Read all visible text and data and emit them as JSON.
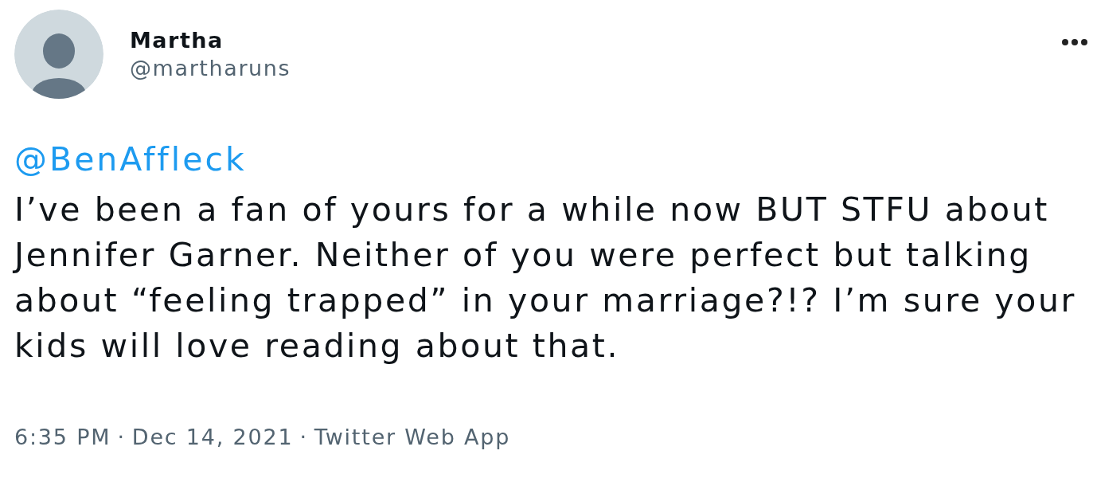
{
  "author": {
    "name": "Martha",
    "handle": "@martharuns"
  },
  "tweet": {
    "mention": "@BenAffleck",
    "text": "I’ve been a fan of yours for a while now BUT STFU about Jennifer Garner. Neither of you were perfect but talking about “feeling trapped” in your marriage?!? I’m sure your kids will love reading about that."
  },
  "footer": {
    "time": "6:35 PM",
    "separator_1": "·",
    "date": "Dec 14, 2021",
    "separator_2": "·",
    "source": "Twitter Web App"
  }
}
